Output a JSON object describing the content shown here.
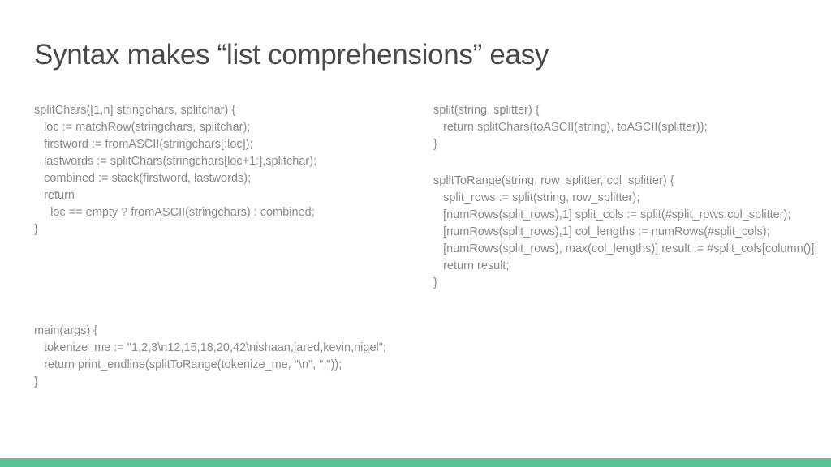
{
  "title": "Syntax makes “list comprehensions” easy",
  "left": {
    "block1": "splitChars([1,n] stringchars, splitchar) {\n   loc := matchRow(stringchars, splitchar);\n   firstword := fromASCII(stringchars[:loc]);\n   lastwords := splitChars(stringchars[loc+1:],splitchar);\n   combined := stack(firstword, lastwords);\n   return\n     loc == empty ? fromASCII(stringchars) : combined;\n}"
  },
  "right": {
    "block1": "split(string, splitter) {\n   return splitChars(toASCII(string), toASCII(splitter));\n}",
    "block2": "splitToRange(string, row_splitter, col_splitter) {\n   split_rows := split(string, row_splitter);\n   [numRows(split_rows),1] split_cols := split(#split_rows,col_splitter);\n   [numRows(split_rows),1] col_lengths := numRows(#split_cols);\n   [numRows(split_rows), max(col_lengths)] result := #split_cols[column()];\n   return result;\n}"
  },
  "bottom": {
    "block1": "main(args) {\n   tokenize_me := \"1,2,3\\n12,15,18,20,42\\nishaan,jared,kevin,nigel\";\n   return print_endline(splitToRange(tokenize_me, \"\\n\", \",\"));\n}"
  }
}
